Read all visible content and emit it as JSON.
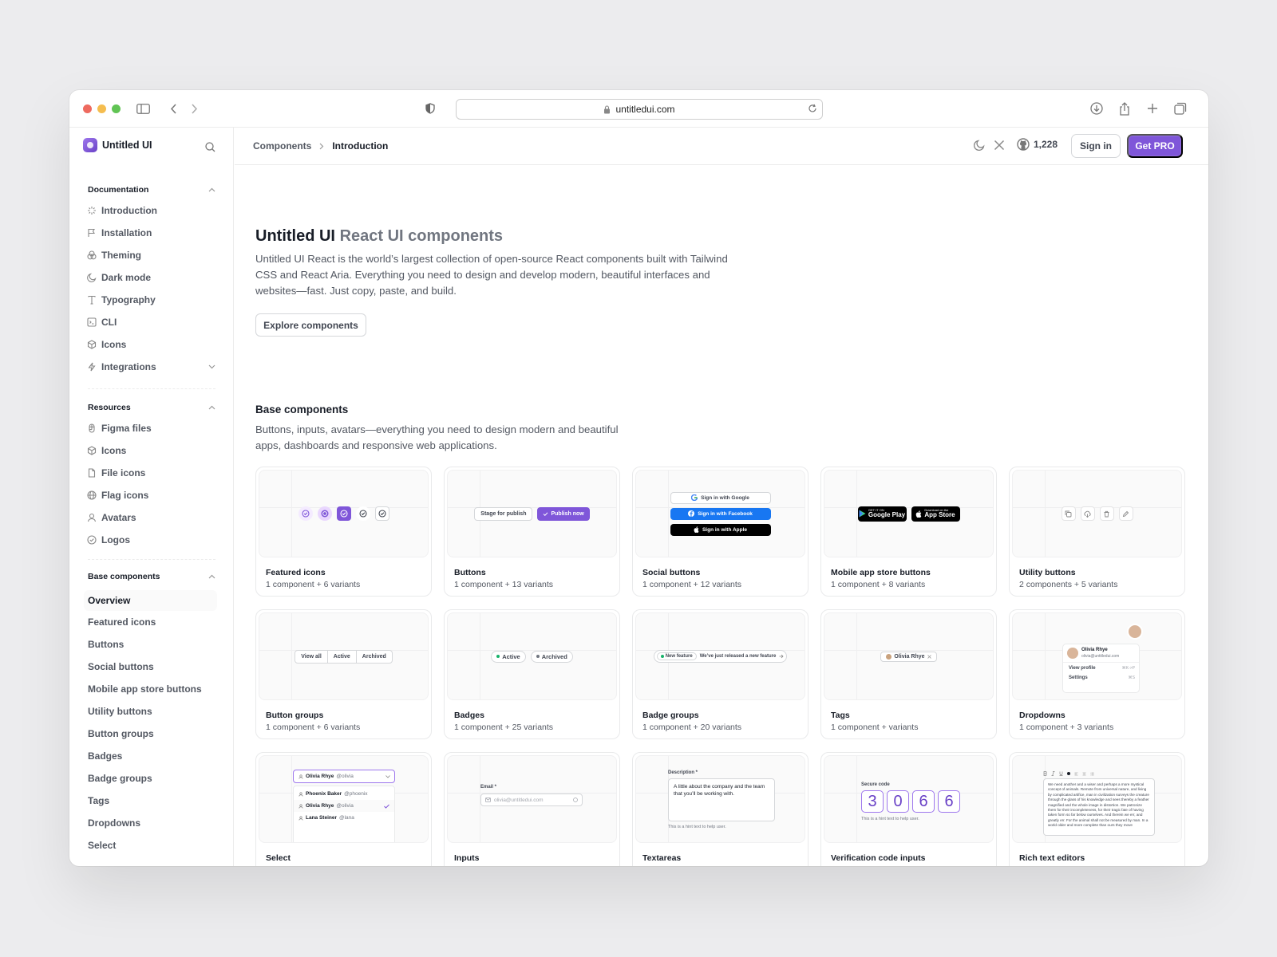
{
  "browser": {
    "url": "untitledui.com"
  },
  "sidebar": {
    "brand": "Untitled UI",
    "documentation": {
      "title": "Documentation",
      "items": [
        "Introduction",
        "Installation",
        "Theming",
        "Dark mode",
        "Typography",
        "CLI",
        "Icons",
        "Integrations"
      ]
    },
    "resources": {
      "title": "Resources",
      "items": [
        "Figma files",
        "Icons",
        "File icons",
        "Flag icons",
        "Avatars",
        "Logos"
      ]
    },
    "base": {
      "title": "Base components",
      "items": [
        "Overview",
        "Featured icons",
        "Buttons",
        "Social buttons",
        "Mobile app store buttons",
        "Utility buttons",
        "Button groups",
        "Badges",
        "Badge groups",
        "Tags",
        "Dropdowns",
        "Select"
      ]
    }
  },
  "topbar": {
    "breadcrumb": [
      "Components",
      "Introduction"
    ],
    "github_stars": "1,228",
    "sign_in": "Sign in",
    "get_pro": "Get PRO"
  },
  "hero": {
    "title_main": "Untitled UI",
    "title_muted": "React UI components",
    "lead": "Untitled UI React is the world’s largest collection of open-source React components built with Tailwind CSS and React Aria. Everything you need to design and develop modern, beautiful interfaces and websites—fast. Just copy, paste, and build.",
    "cta": "Explore components"
  },
  "base_section": {
    "title": "Base components",
    "description": "Buttons, inputs, avatars—everything you need to design modern and beautiful apps, dashboards and responsive web applications."
  },
  "cards": [
    {
      "title": "Featured icons",
      "subtitle": "1 component + 6 variants"
    },
    {
      "title": "Buttons",
      "subtitle": "1 component + 13 variants"
    },
    {
      "title": "Social buttons",
      "subtitle": "1 component + 12 variants"
    },
    {
      "title": "Mobile app store buttons",
      "subtitle": "1 component + 8 variants"
    },
    {
      "title": "Utility buttons",
      "subtitle": "2 components + 5 variants"
    },
    {
      "title": "Button groups",
      "subtitle": "1 component + 6 variants"
    },
    {
      "title": "Badges",
      "subtitle": "1 component + 25 variants"
    },
    {
      "title": "Badge groups",
      "subtitle": "1 component + 20 variants"
    },
    {
      "title": "Tags",
      "subtitle": "1 component + variants"
    },
    {
      "title": "Dropdowns",
      "subtitle": "1 component + 3 variants"
    },
    {
      "title": "Select",
      "subtitle": ""
    },
    {
      "title": "Inputs",
      "subtitle": ""
    },
    {
      "title": "Textareas",
      "subtitle": ""
    },
    {
      "title": "Verification code inputs",
      "subtitle": ""
    },
    {
      "title": "Rich text editors",
      "subtitle": ""
    }
  ],
  "previews": {
    "buttons": {
      "secondary": "Stage for publish",
      "primary": "Publish now"
    },
    "social": {
      "google": "Sign in with Google",
      "facebook": "Sign in with Facebook",
      "apple": "Sign in with Apple"
    },
    "stores": {
      "google_small": "GET IT ON",
      "google": "Google Play",
      "apple_small": "Download on the",
      "apple": "App Store"
    },
    "button_group": [
      "View all",
      "Active",
      "Archived"
    ],
    "badges": [
      "Active",
      "Archived"
    ],
    "badge_group": {
      "label": "New feature",
      "text": "We’ve just released a new feature"
    },
    "tag": {
      "label": "Olivia Rhye"
    },
    "dropdown": {
      "name": "Olivia Rhye",
      "email": "olivia@untitledui.com",
      "items": [
        {
          "label": "View profile",
          "shortcut": "⌘K->P"
        },
        {
          "label": "Settings",
          "shortcut": "⌘S"
        }
      ]
    },
    "select": {
      "selected": "Olivia Rhye",
      "selected_handle": "@olivia",
      "options": [
        {
          "name": "Phoenix Baker",
          "handle": "@phoenix"
        },
        {
          "name": "Olivia Rhye",
          "handle": "@olivia"
        },
        {
          "name": "Lana Steiner",
          "handle": "@lana"
        }
      ]
    },
    "input": {
      "label": "Email *",
      "placeholder": "olivia@untitledui.com"
    },
    "textarea": {
      "label": "Description *",
      "value": "A little about the company and the team that you’ll be working with.",
      "hint": "This is a hint text to help user."
    },
    "verification": {
      "label": "Secure code",
      "digits": [
        "3",
        "0",
        "6",
        "6"
      ],
      "hint": "This is a hint text to help user."
    },
    "rich_text": {
      "text": "We need another and a wiser and perhaps a more mystical concept of animals. Remote from universal nature, and living by complicated artifice, man in civilization surveys the creature through the glass of his knowledge and sees thereby a feather magnified and the whole image in distortion. We patronize them for their incompleteness, for their tragic fate of having taken form so far below ourselves. And therein we err, and greatly err. For the animal shall not be measured by man. In a world older and more complete than ours they move"
    }
  },
  "colors": {
    "accent": "#7f56d9",
    "accent_dark": "#6941c6",
    "text": "#181d27",
    "muted": "#535862"
  }
}
